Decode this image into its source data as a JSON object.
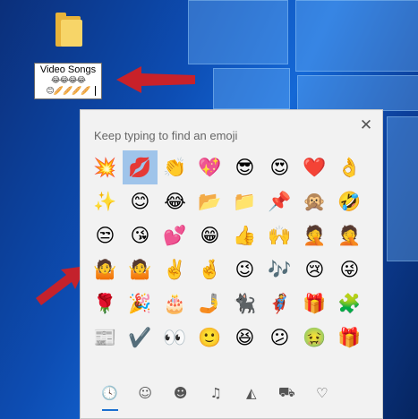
{
  "desktop": {
    "folder_name": "Video Songs",
    "rename_line2": "😂😂😂😂",
    "rename_line3": "😊🥖🥖🥖🥖"
  },
  "panel": {
    "hint": "Keep typing to find an emoji",
    "close_glyph": "✕",
    "emoji_rows": [
      [
        "💥",
        "💋",
        "👏",
        "💖",
        "😎",
        "😍",
        "❤️",
        "👌"
      ],
      [
        "✨",
        "😊",
        "😂",
        "📂",
        "📁",
        "📌",
        "🙊",
        "🤣"
      ],
      [
        "😒",
        "😘",
        "💕",
        "😁",
        "👍",
        "🙌",
        "🤦",
        "🤦"
      ],
      [
        "🤷",
        "🤷",
        "✌️",
        "🤞",
        "😉",
        "🎶",
        "😢",
        "😜"
      ],
      [
        "🌹",
        "🎉",
        "🎂",
        "🤳",
        "🐈‍⬛",
        "🦸",
        "🎁",
        "🧩"
      ],
      [
        "📰",
        "✔️",
        "👀",
        "🙂",
        "😆",
        "😕",
        "🤢",
        "🎁"
      ]
    ],
    "selected_index": 1,
    "category_tabs": [
      {
        "name": "recent",
        "glyph": "🕓"
      },
      {
        "name": "smileys",
        "glyph": "☺"
      },
      {
        "name": "people",
        "glyph": "☻"
      },
      {
        "name": "celebration",
        "glyph": "♫"
      },
      {
        "name": "food",
        "glyph": "◭"
      },
      {
        "name": "travel",
        "glyph": "⛟"
      },
      {
        "name": "symbols",
        "glyph": "♡"
      }
    ],
    "active_tab": 0
  },
  "colors": {
    "accent": "#1a6fd0",
    "selected_cell": "#9fc4ea",
    "arrow": "#d81e1e"
  }
}
